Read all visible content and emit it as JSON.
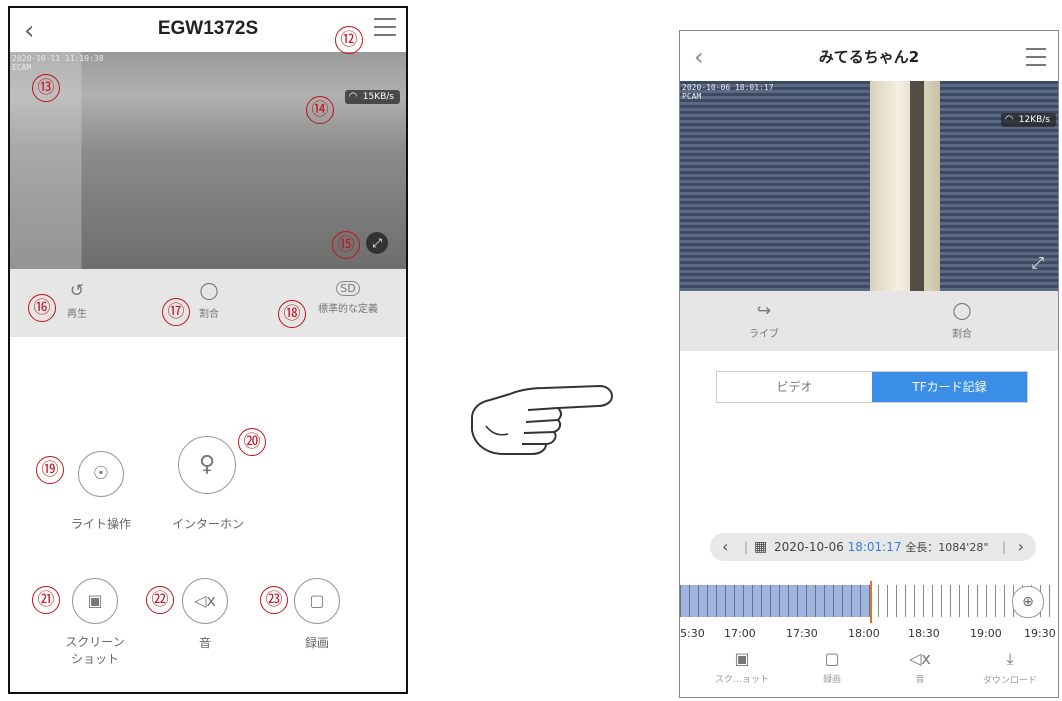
{
  "left": {
    "title": "EGW1372S",
    "timestamp": "2020-10-11 11:19:38",
    "channel": "ECAM",
    "wifi_rate": "15KB/s",
    "toolbar": [
      {
        "icon": "history-icon",
        "label": "再生"
      },
      {
        "icon": "ratio-icon",
        "label": "割合"
      },
      {
        "icon": "sd-icon",
        "label": "標準的な定義"
      }
    ],
    "controls": [
      {
        "icon": "bulb-icon",
        "label": "ライト操作"
      },
      {
        "icon": "mic-icon",
        "label": "インターホン"
      },
      {
        "icon": "camera-icon",
        "label": "スクリーン\nショット"
      },
      {
        "icon": "mute-icon",
        "label": "音"
      },
      {
        "icon": "video-icon",
        "label": "録画"
      }
    ],
    "markers": [
      "⑫",
      "⑬",
      "⑭",
      "⑮",
      "⑯",
      "⑰",
      "⑱",
      "⑲",
      "⑳",
      "㉑",
      "㉒",
      "㉓"
    ],
    "colors": {
      "marker": "#c2121c"
    }
  },
  "right": {
    "title": "みてるちゃん2",
    "timestamp": "2020-10-06 18:01:17",
    "channel": "PCAM",
    "wifi_rate": "12KB/s",
    "toolbar": [
      {
        "icon": "live-icon",
        "label": "ライブ"
      },
      {
        "icon": "ratio-icon",
        "label": "割合"
      }
    ],
    "tabs": [
      {
        "label": "ビデオ",
        "active": false
      },
      {
        "label": "TFカード記録",
        "active": true
      }
    ],
    "date": "2020-10-06",
    "time": "18:01:17",
    "duration_label": "全長：1084'28\"",
    "timeline_labels": [
      "5:30",
      "17:00",
      "17:30",
      "18:00",
      "18:30",
      "19:00",
      "19:30"
    ],
    "bottom": [
      {
        "icon": "camera-icon",
        "label": "スク…ョット"
      },
      {
        "icon": "video-icon",
        "label": "録画"
      },
      {
        "icon": "mute-icon",
        "label": "音"
      },
      {
        "icon": "download-icon",
        "label": "ダウンロード"
      }
    ],
    "colors": {
      "accent": "#3a8ee6",
      "time_highlight": "#3a7fd6"
    }
  }
}
